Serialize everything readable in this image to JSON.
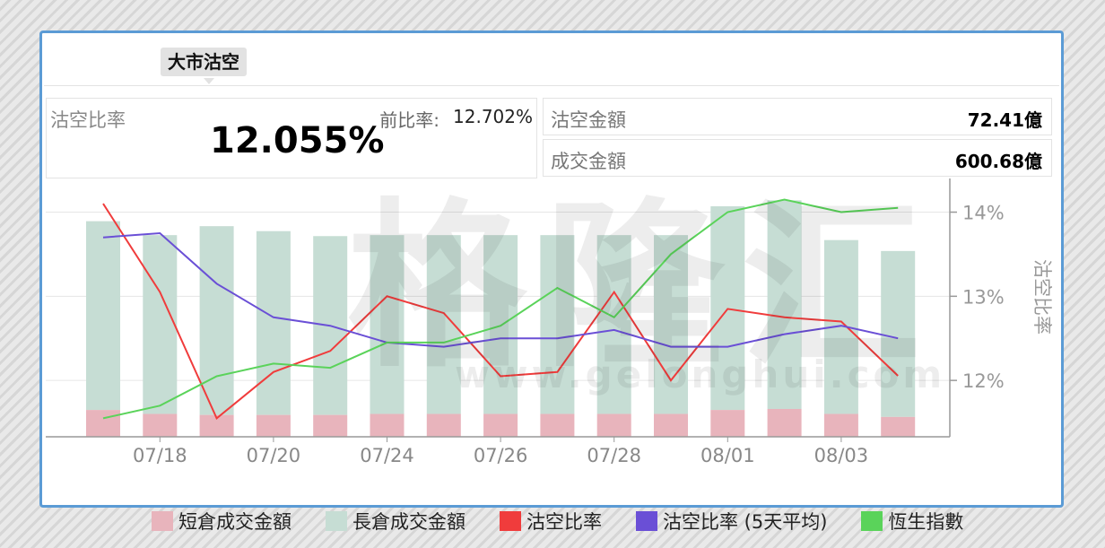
{
  "tab": {
    "label": "大市沽空"
  },
  "summary": {
    "ratio_label": "沽空比率",
    "ratio_value": "12.055%",
    "prev_label": "前比率:",
    "prev_value": "12.702%",
    "short_amount_label": "沽空金額",
    "short_amount_value": "72.41億",
    "turnover_label": "成交金額",
    "turnover_value": "600.68億"
  },
  "watermark": {
    "text": "格隆汇",
    "url": "www.gelonghui.com"
  },
  "colors": {
    "short_bar": "#e8b4bc",
    "long_bar": "#c6ddd4",
    "ratio_line": "#f03c3c",
    "avg_line": "#6a4fd6",
    "hsi_line": "#5ad35a"
  },
  "chart_data": {
    "type": "line",
    "x_tick_labels": [
      "07/18",
      "07/20",
      "07/24",
      "07/26",
      "07/28",
      "08/01",
      "08/03"
    ],
    "y_right": {
      "label": "沽空比率",
      "ticks": [
        "12%",
        "13%",
        "14%"
      ],
      "tick_values": [
        12,
        13,
        14
      ],
      "range": [
        11.33,
        14.4
      ]
    },
    "bars": {
      "short": [
        0.27,
        0.23,
        0.22,
        0.22,
        0.22,
        0.23,
        0.23,
        0.23,
        0.23,
        0.23,
        0.23,
        0.27,
        0.28,
        0.23,
        0.2
      ],
      "long": [
        1.9,
        1.8,
        1.9,
        1.85,
        1.8,
        1.8,
        1.8,
        1.8,
        1.8,
        1.8,
        1.8,
        2.05,
        2.1,
        1.75,
        1.67
      ],
      "scale_max": 2.6
    },
    "series": [
      {
        "key": "ratio",
        "name": "沽空比率",
        "values": [
          14.1,
          13.05,
          11.55,
          12.1,
          12.35,
          13.0,
          12.8,
          12.05,
          12.1,
          13.05,
          12.0,
          12.85,
          12.75,
          12.7,
          12.055
        ]
      },
      {
        "key": "avg",
        "name": "沽空比率 (5天平均)",
        "values": [
          13.7,
          13.75,
          13.15,
          12.75,
          12.65,
          12.45,
          12.4,
          12.5,
          12.5,
          12.6,
          12.4,
          12.4,
          12.55,
          12.65,
          12.5
        ]
      },
      {
        "key": "hsi",
        "name": "恆生指數",
        "values": [
          11.55,
          11.7,
          12.05,
          12.2,
          12.15,
          12.45,
          12.45,
          12.65,
          13.1,
          12.75,
          13.5,
          14.0,
          14.15,
          14.0,
          14.05
        ]
      }
    ],
    "legend": [
      {
        "key": "short",
        "label": "短倉成交金額"
      },
      {
        "key": "long",
        "label": "長倉成交金額"
      },
      {
        "key": "ratio",
        "label": "沽空比率"
      },
      {
        "key": "avg",
        "label": "沽空比率 (5天平均)"
      },
      {
        "key": "hsi",
        "label": "恆生指數"
      }
    ]
  }
}
